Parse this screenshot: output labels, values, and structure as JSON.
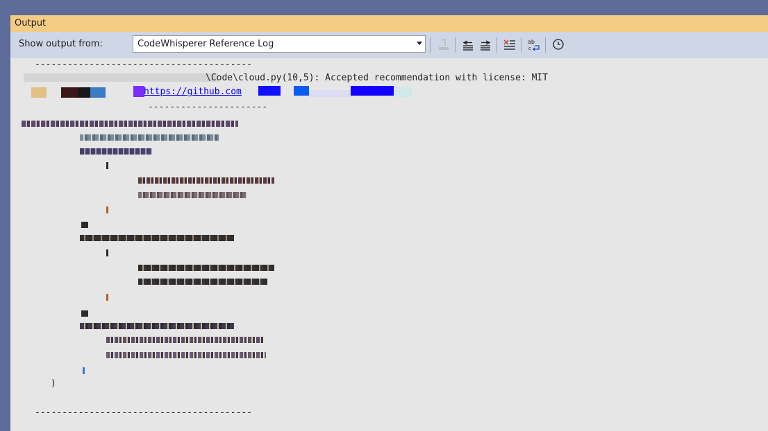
{
  "panel": {
    "title": "Output"
  },
  "toolbar": {
    "show_output_label": "Show output from:",
    "source_selected": "CodeWhisperer Reference Log",
    "icons": [
      "find-message-in-code-icon",
      "go-to-previous-message-icon",
      "go-to-next-message-icon",
      "clear-all-icon",
      "toggle-word-wrap-icon",
      "toggle-timestamp-icon"
    ]
  },
  "log": {
    "separator_top": "----------------------------------------",
    "entry_text": "\\Code\\cloud.py(10,5): Accepted recommendation with license: MIT",
    "link_text": "https://github.com",
    "separator_mid": "----------------------",
    "separator_bottom": "----------------------------------------",
    "code_closing_paren": ")"
  },
  "colors": {
    "title_bg": "#f5cc84",
    "toolbar_bg": "#cfd6e5",
    "content_bg": "#e6e6e6",
    "link": "#0000ee",
    "frame": "#5d6b99"
  }
}
